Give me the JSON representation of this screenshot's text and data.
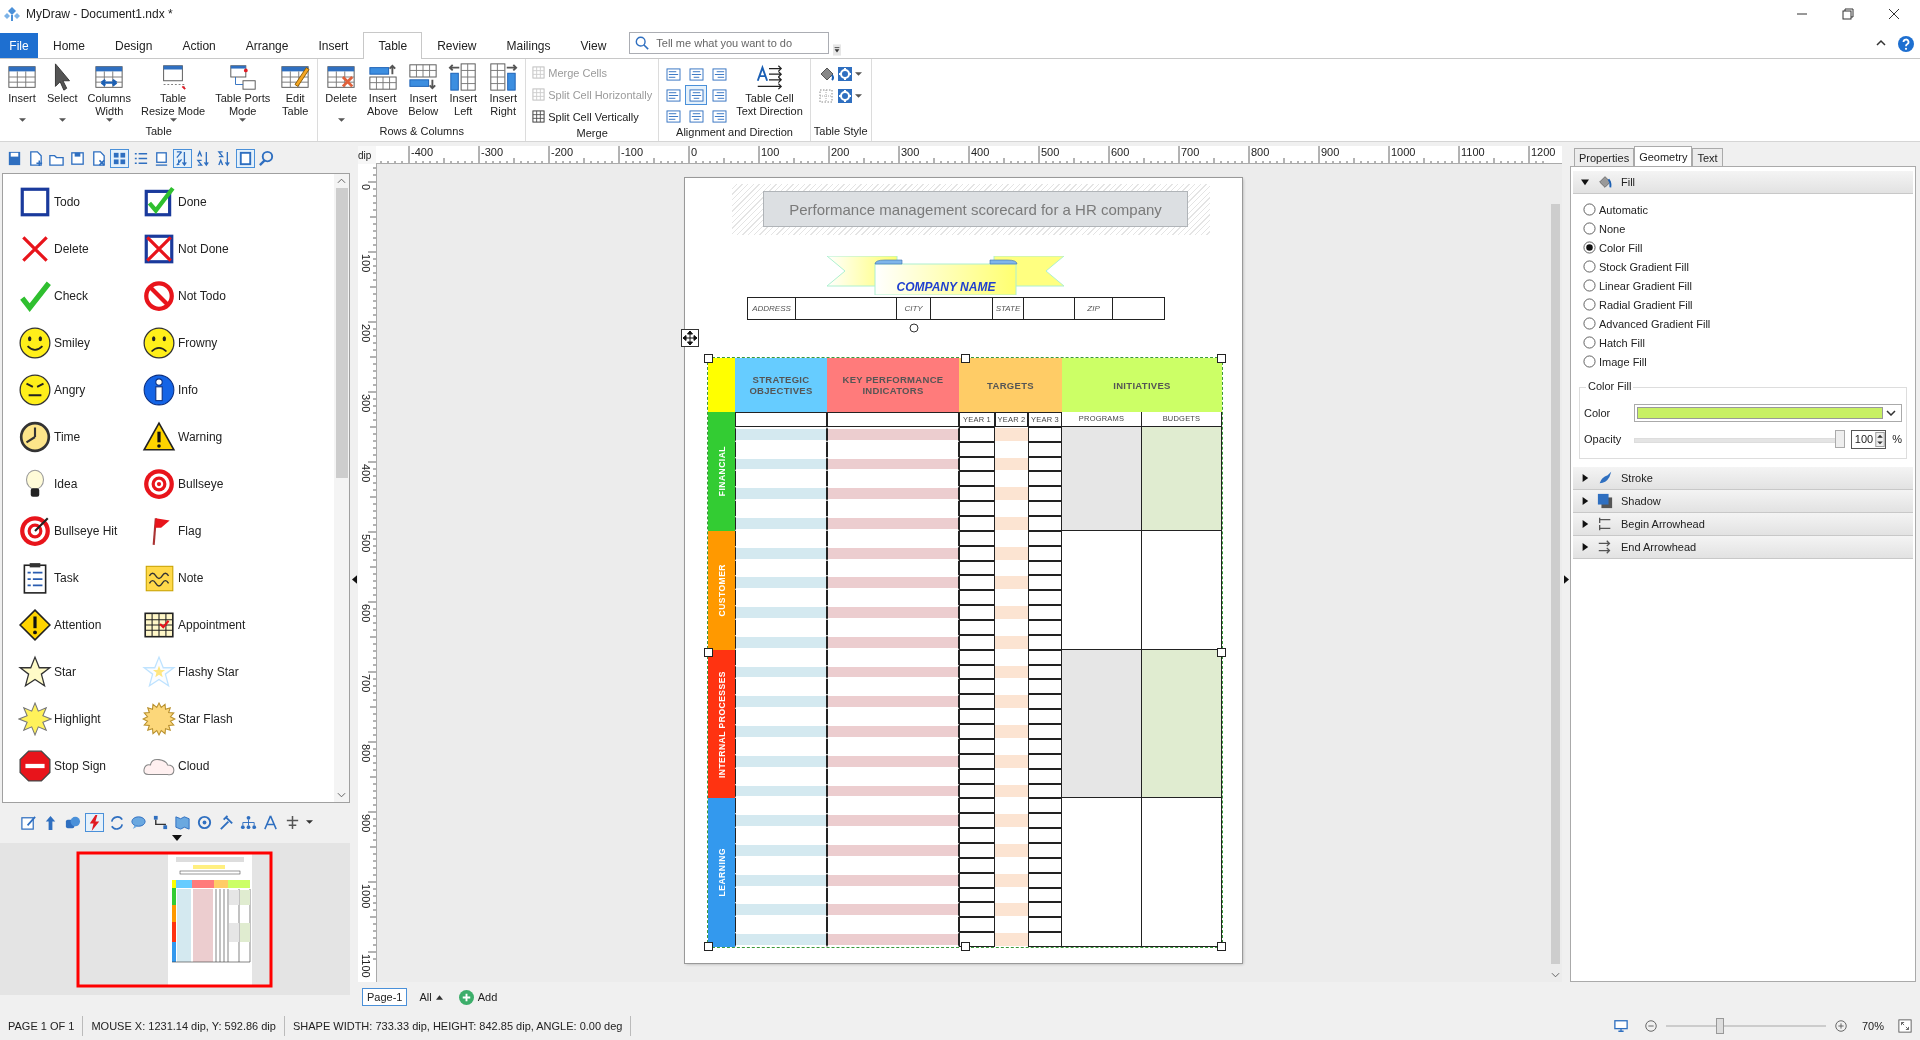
{
  "window": {
    "title": "MyDraw - Document1.ndx *"
  },
  "tabs": [
    {
      "label": "File",
      "kind": "file",
      "selected": false
    },
    {
      "label": "Home",
      "kind": "tab",
      "selected": false
    },
    {
      "label": "Design",
      "kind": "tab",
      "selected": false
    },
    {
      "label": "Action",
      "kind": "tab",
      "selected": false
    },
    {
      "label": "Arrange",
      "kind": "tab",
      "selected": false
    },
    {
      "label": "Insert",
      "kind": "tab",
      "selected": false
    },
    {
      "label": "Table",
      "kind": "tab",
      "selected": true
    },
    {
      "label": "Review",
      "kind": "tab",
      "selected": false
    },
    {
      "label": "Mailings",
      "kind": "tab",
      "selected": false
    },
    {
      "label": "View",
      "kind": "tab",
      "selected": false
    }
  ],
  "search": {
    "placeholder": "Tell me what you want to do"
  },
  "ribbon_groups": [
    {
      "label": "Table",
      "kind": "large",
      "buttons": [
        {
          "label": "Insert",
          "dropdown": true
        },
        {
          "label": "Select",
          "dropdown": true
        },
        {
          "label": "Columns\nWidth",
          "dropdown": true
        },
        {
          "label": "Table\nResize Mode",
          "dropdown": true
        },
        {
          "label": "Table Ports\nMode",
          "dropdown": true
        },
        {
          "label": "Edit\nTable",
          "dropdown": false
        }
      ]
    },
    {
      "label": "Rows & Columns",
      "kind": "large",
      "buttons": [
        {
          "label": "Delete",
          "dropdown": true
        },
        {
          "label": "Insert\nAbove",
          "dropdown": false
        },
        {
          "label": "Insert\nBelow",
          "dropdown": false
        },
        {
          "label": "Insert\nLeft",
          "dropdown": false
        },
        {
          "label": "Insert\nRight",
          "dropdown": false
        }
      ]
    },
    {
      "label": "Merge",
      "kind": "small",
      "buttons": [
        {
          "label": "Merge Cells",
          "disabled": true
        },
        {
          "label": "Split Cell Horizontally",
          "disabled": true
        },
        {
          "label": "Split Cell Vertically",
          "disabled": false
        }
      ]
    },
    {
      "label": "Alignment and Direction",
      "kind": "align",
      "aligns": [
        {
          "selected": false
        },
        {
          "selected": false
        },
        {
          "selected": false
        },
        {
          "selected": false
        },
        {
          "selected": true
        },
        {
          "selected": false
        },
        {
          "selected": false
        },
        {
          "selected": false
        },
        {
          "selected": false
        }
      ],
      "buttons": [
        {
          "label": "Table Cell\nText Direction",
          "dropdown": false
        }
      ]
    },
    {
      "label": "Table Style",
      "kind": "style",
      "buttons": [
        {
          "dropdown": false
        },
        {
          "dropdown": true
        },
        {
          "dropdown": false
        },
        {
          "dropdown": true
        }
      ]
    }
  ],
  "shapes": [
    "Todo",
    "Done",
    "Delete",
    "Not Done",
    "Check",
    "Not Todo",
    "Smiley",
    "Frowny",
    "Angry",
    "Info",
    "Time",
    "Warning",
    "Idea",
    "Bullseye",
    "Bullseye Hit",
    "Flag",
    "Task",
    "Note",
    "Attention",
    "Appointment",
    "Star",
    "Flashy Star",
    "Highlight",
    "Star Flash",
    "Stop Sign",
    "Cloud"
  ],
  "canvas": {
    "ruler_unit": "dip",
    "h_ruler": [
      "-400",
      "-300",
      "-200",
      "-100",
      "0",
      "100",
      "200",
      "300",
      "400",
      "500",
      "600",
      "700",
      "800",
      "900",
      "1000",
      "1100",
      "1200"
    ],
    "v_ruler": [
      "0",
      "100",
      "200",
      "300",
      "400",
      "500",
      "600",
      "700",
      "800",
      "900",
      "1000",
      "1100"
    ],
    "title": "Performance management scorecard for a HR company",
    "company": "COMPANY NAME",
    "address_fields": [
      "ADDRESS",
      "CITY",
      "STATE",
      "ZIP"
    ],
    "scorecard": {
      "headers": [
        {
          "label": "STRATEGIC OBJECTIVES",
          "color": "#66ccff"
        },
        {
          "label": "KEY PERFORMANCE INDICATORS",
          "color": "#ff7b7b"
        },
        {
          "label": "TARGETS",
          "color": "#ffcc66"
        },
        {
          "label": "INITIATIVES",
          "color": "#ccff66"
        }
      ],
      "subheaders": [
        "YEAR 1",
        "YEAR 2",
        "YEAR 3",
        "PROGRAMS",
        "BUDGETS"
      ],
      "sections": [
        {
          "label": "FINANCIAL",
          "color": "#33cc33",
          "shaded": true
        },
        {
          "label": "CUSTOMER",
          "color": "#ff9900",
          "shaded": false
        },
        {
          "label": "INTERNAL PROCESSES",
          "color": "#ff3311",
          "shaded": true
        },
        {
          "label": "LEARNING",
          "color": "#3399ee",
          "shaded": false
        }
      ]
    }
  },
  "page_tabs": [
    {
      "label": "Page-1",
      "selected": true
    }
  ],
  "page_filter": "All",
  "add_page": "Add",
  "properties": {
    "tabs": [
      {
        "label": "Properties",
        "selected": false
      },
      {
        "label": "Geometry",
        "selected": true
      },
      {
        "label": "Text",
        "selected": false
      }
    ],
    "sections": [
      {
        "label": "Fill",
        "expanded": true,
        "options": [
          {
            "label": "Automatic",
            "selected": false
          },
          {
            "label": "None",
            "selected": false
          },
          {
            "label": "Color Fill",
            "selected": true
          },
          {
            "label": "Stock Gradient Fill",
            "selected": false
          },
          {
            "label": "Linear Gradient Fill",
            "selected": false
          },
          {
            "label": "Radial Gradient Fill",
            "selected": false
          },
          {
            "label": "Advanced Gradient Fill",
            "selected": false
          },
          {
            "label": "Hatch Fill",
            "selected": false
          },
          {
            "label": "Image Fill",
            "selected": false
          }
        ],
        "color_fill": {
          "title": "Color Fill",
          "color_label": "Color",
          "color": "#c8f064",
          "opacity_label": "Opacity",
          "opacity": {
            "level": 1.0
          },
          "opacity_value": "100",
          "unit": "%"
        }
      },
      {
        "label": "Stroke",
        "expanded": false
      },
      {
        "label": "Shadow",
        "expanded": false
      },
      {
        "label": "Begin Arrowhead",
        "expanded": false
      },
      {
        "label": "End Arrowhead",
        "expanded": false
      }
    ]
  },
  "status_bar": {
    "items": [
      "PAGE 1 OF 1",
      "MOUSE X: 1231.14 dip, Y: 592.86 dip",
      "SHAPE WIDTH: 733.33 dip, HEIGHT: 842.85 dip, ANGLE: 0.00 deg"
    ],
    "zoom": {
      "level": 0.33
    },
    "zoom_label": "70%"
  }
}
